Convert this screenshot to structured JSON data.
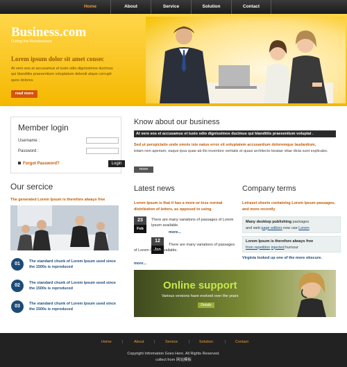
{
  "nav": {
    "items": [
      {
        "label": "Home",
        "active": true
      },
      {
        "label": "About",
        "active": false
      },
      {
        "label": "Service",
        "active": false
      },
      {
        "label": "Solution",
        "active": false
      },
      {
        "label": "Contact",
        "active": false
      }
    ]
  },
  "hero": {
    "logo": "Business.com",
    "tagline": "During the Renaissance",
    "headline": "Lorem ipsum dolor sit amet consec",
    "body": "At vero eos et accusamus et iusto odio dignissimos ducimus qui blanditiis praesentium voluptatum deleniti atque corrupti quos dolores",
    "button": "read more"
  },
  "member": {
    "title": "Member login",
    "username_label": "Username :",
    "password_label": "Password :",
    "forgot": "Forgot Password?",
    "login_button": "Login"
  },
  "service": {
    "title": "Our sercice",
    "subtitle": "The generated Lorem Ipsum is therefore always free",
    "items": [
      {
        "num": "01",
        "text": "The standard chunk of Lorem Ipsum used since the 1500s is reproduced"
      },
      {
        "num": "02",
        "text": "The standard chunk of Lorem Ipsum used since the 1500s is reproduced"
      },
      {
        "num": "03",
        "text": "The standard chunk of Lorem Ipsum used since the 1500s is reproduced"
      }
    ]
  },
  "know": {
    "title": "Know about our business",
    "bar": "At vero eos et accusamus et iusto odio dignissimos ducimus qui blanditiis praesentium voluptat .",
    "orange": "Sed ut perspiciatis unde omnis iste natus error sit voluptatem accusantium doloremque laudantium,",
    "body": "totam rem aperiam, eaque ipsa quae ab illo inventore veritatis et quasi architecto beatae vitae dicta sunt explicabo.",
    "more": "more"
  },
  "news": {
    "title": "Latest news",
    "subtitle": "Lorem Ipsum is that it has a more-or-less normal distribution of letters, as opposed to using",
    "items": [
      {
        "day": "23",
        "month": "Feb",
        "text": "There are many variations of passages of Lorem Ipsum available.",
        "more": "more..."
      },
      {
        "day": "12",
        "month": "Jan",
        "text": "There are many variations of passages of Lorem Ipsum available.",
        "more": "more..."
      }
    ]
  },
  "company": {
    "title": "Company terms",
    "subtitle": "Letraset sheets containing Lorem Ipsum passages, and more recently",
    "box1_bold": "Many desktop publishing",
    "box1_rest": " packages",
    "box1_line2a": "and web ",
    "box1_link": "page editors",
    "box1_line2b": " now use ",
    "box1_link2": "Lorem",
    "box2_bold": "Lorem Ipsum is therefore always free",
    "box2_link": "from repetition",
    "box2_mid": " ",
    "box2_link2": "injected",
    "box2_rest": " humour",
    "link": "Virginia looked up one of the more obscure."
  },
  "online": {
    "title": "Online support",
    "subtitle": "Various versions have evolved over the years",
    "button": "Details"
  },
  "footer": {
    "links": [
      "Home",
      "About",
      "Service",
      "Solution",
      "Contact"
    ],
    "copyright": "Copyright Information Goes Here. All Rights Reserved.",
    "collect": "collect from 网站模板"
  }
}
